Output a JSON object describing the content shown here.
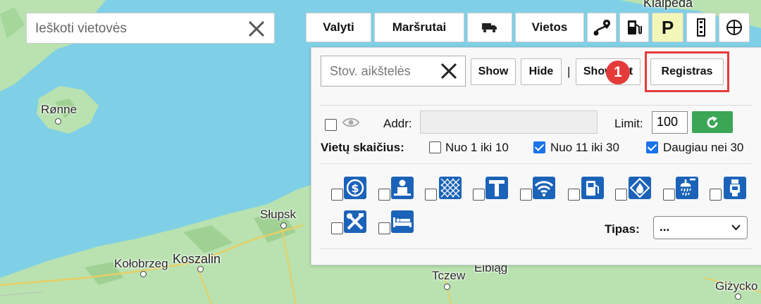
{
  "map": {
    "labels": {
      "klaipeda": "Klaipėda",
      "ronne": "Rønne",
      "slupsk": "Słupsk",
      "kolobrzeg": "Kołobrzeg",
      "koszalin": "Koszalin",
      "tczew": "Tczew",
      "elblag": "Elbląg",
      "gizycko": "Giżycko"
    }
  },
  "search": {
    "placeholder": "Ieškoti vietovės"
  },
  "toolbar": {
    "clear_label": "Valyti",
    "routes_label": "Maršrutai",
    "places_label": "Vietos",
    "parking_label": "P"
  },
  "panel": {
    "filter_placeholder": "Stov. aikštelės",
    "show_label": "Show",
    "hide_label": "Hide",
    "separator": "|",
    "show_list_label": "Show list",
    "register_label": "Registras",
    "step_badge": "1",
    "addr_label": "Addr:",
    "addr_value": "",
    "limit_label": "Limit:",
    "limit_value": "100",
    "count_label": "Vietų skaičius:",
    "count_options": [
      {
        "label": "Nuo 1 iki 10",
        "checked": false
      },
      {
        "label": "Nuo 11 iki 30",
        "checked": true
      },
      {
        "label": "Daugiau nei 30",
        "checked": true
      }
    ],
    "type_label": "Tipas:",
    "type_value": "...",
    "service_icons": [
      "money-icon",
      "restaurant-icon",
      "fence-icon",
      "shower-icon",
      "wifi-icon",
      "fuel-icon",
      "fire-icon",
      "shower-head-icon",
      "toilet-icon",
      "repair-icon",
      "bed-icon"
    ]
  },
  "colors": {
    "sea": "#7fd0e6",
    "land": "#b9e2b0",
    "accent_red": "#e53a3a",
    "service_blue": "#1b63b8",
    "refresh_green": "#3aa656",
    "parking_bg": "#f2f7b9"
  }
}
